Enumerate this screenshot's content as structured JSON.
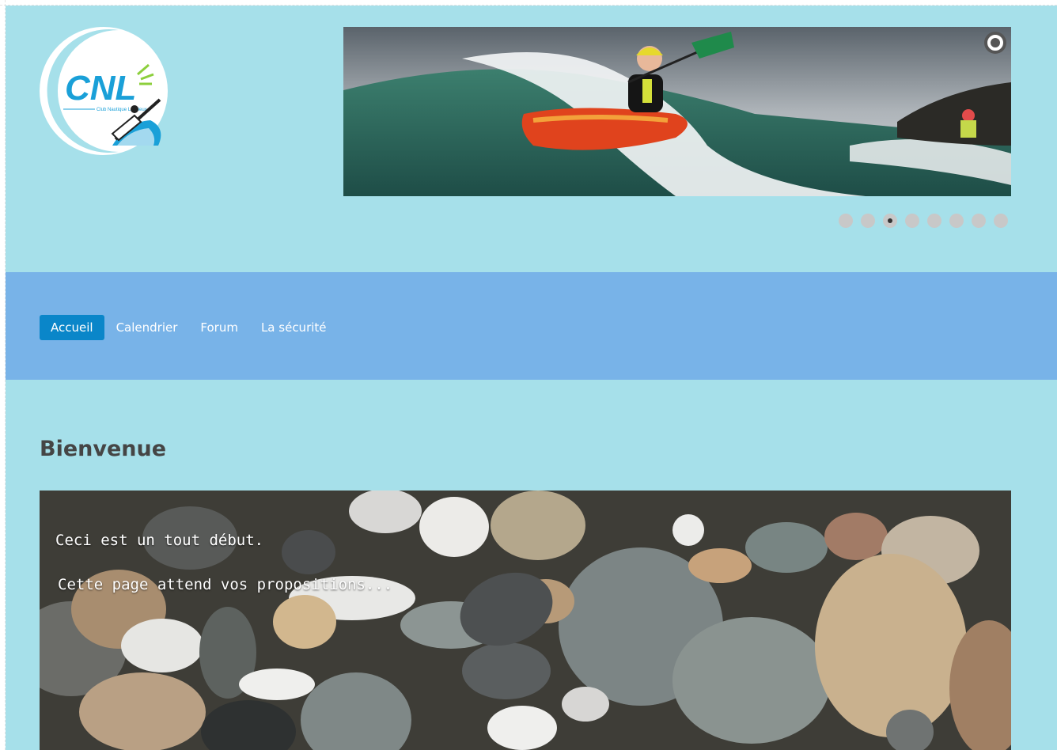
{
  "logo": {
    "text": "CNL",
    "subtitle": "Club Nautique Lancieux",
    "accent_color": "#1aa0d8",
    "line_color": "#8ccf3c"
  },
  "slideshow": {
    "total_slides": 8,
    "active_slide": 3,
    "pause_icon": "pause-ring-icon"
  },
  "nav": {
    "items": [
      {
        "label": "Accueil",
        "active": true
      },
      {
        "label": "Calendrier",
        "active": false
      },
      {
        "label": "Forum",
        "active": false
      },
      {
        "label": "La sécurité",
        "active": false
      }
    ]
  },
  "main": {
    "title": "Bienvenue",
    "hero_line1": "Ceci est un tout début.",
    "hero_line2": "Cette page attend vos propositions..."
  },
  "colors": {
    "page_bg": "#a6e0ea",
    "nav_bg": "#78b3e8",
    "nav_active": "#0a86c9",
    "title": "#454545"
  }
}
